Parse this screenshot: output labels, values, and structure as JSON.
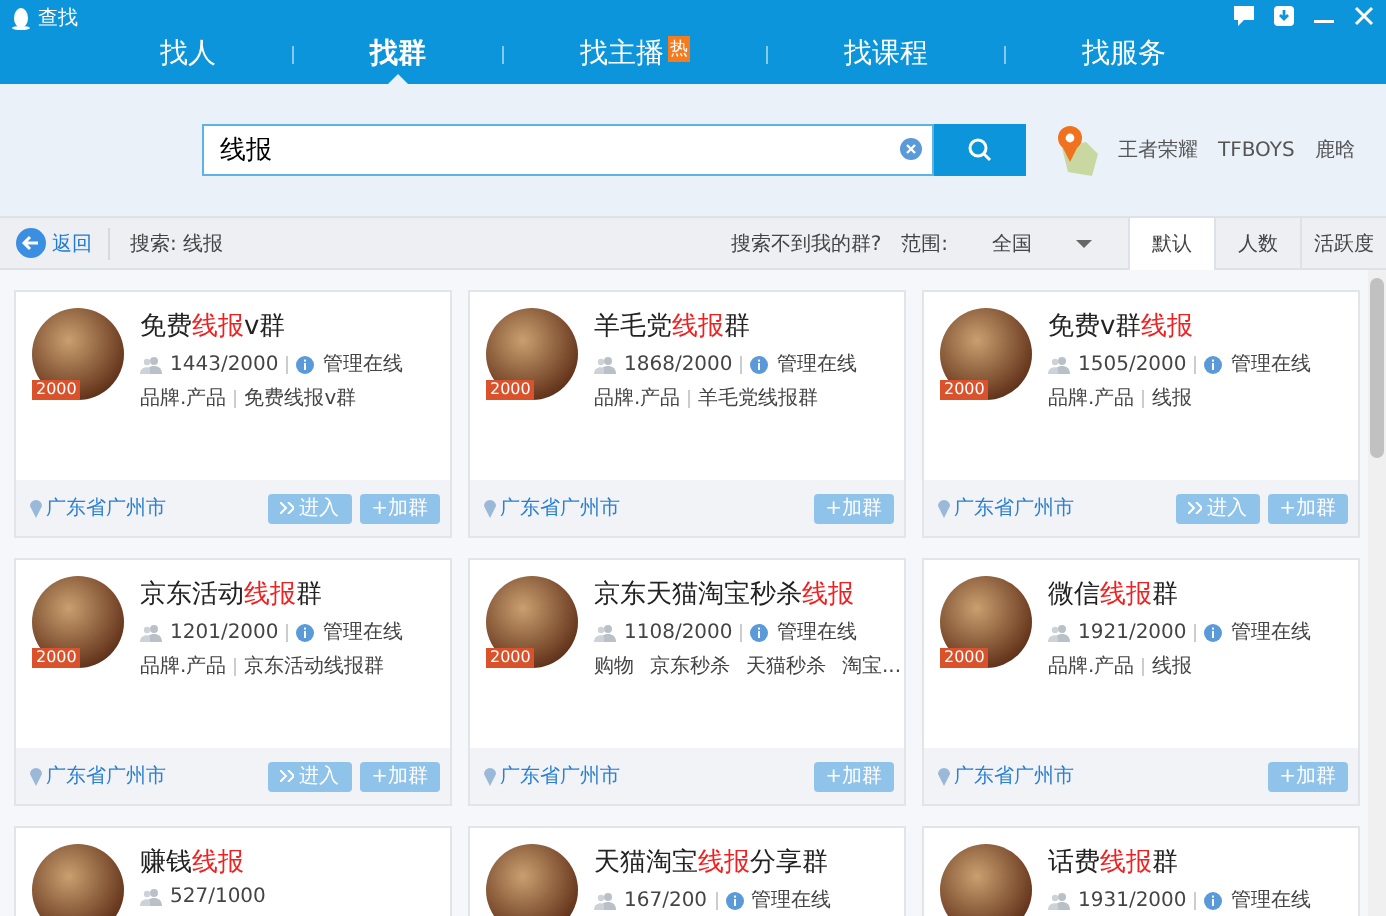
{
  "window": {
    "title": "查找"
  },
  "tabs": [
    {
      "label": "找人",
      "selected": false
    },
    {
      "label": "找群",
      "selected": true
    },
    {
      "label": "找主播",
      "selected": false,
      "hot": "热"
    },
    {
      "label": "找课程",
      "selected": false
    },
    {
      "label": "找服务",
      "selected": false
    }
  ],
  "search": {
    "value": "线报",
    "hot_words": [
      "王者荣耀",
      "TFBOYS",
      "鹿晗"
    ]
  },
  "filter_bar": {
    "back": "返回",
    "query": "搜索: 线报",
    "not_found": "搜索不到我的群?",
    "range_label": "范围:",
    "range_value": "全国",
    "sorts": [
      {
        "label": "默认",
        "selected": true
      },
      {
        "label": "人数",
        "selected": false
      },
      {
        "label": "活跃度",
        "selected": false
      }
    ]
  },
  "groups": [
    {
      "name": [
        {
          "text": "免费",
          "highlight": false
        },
        {
          "text": "线报",
          "highlight": true
        },
        {
          "text": "v群",
          "highlight": false
        }
      ],
      "badge": "2000",
      "members": "1443/2000",
      "admin": "管理在线",
      "tags": [
        "品牌.产品",
        "免费线报v群"
      ],
      "location": "广东省广州市",
      "enter": "进入",
      "join": "+加群"
    },
    {
      "name": [
        {
          "text": "羊毛党",
          "highlight": false
        },
        {
          "text": "线报",
          "highlight": true
        },
        {
          "text": "群",
          "highlight": false
        }
      ],
      "badge": "2000",
      "members": "1868/2000",
      "admin": "管理在线",
      "tags": [
        "品牌.产品",
        "羊毛党线报群"
      ],
      "location": "广东省广州市",
      "join": "+加群"
    },
    {
      "name": [
        {
          "text": "免费v群",
          "highlight": false
        },
        {
          "text": "线报",
          "highlight": true
        }
      ],
      "badge": "2000",
      "members": "1505/2000",
      "admin": "管理在线",
      "tags": [
        "品牌.产品",
        "线报"
      ],
      "location": "广东省广州市",
      "enter": "进入",
      "join": "+加群"
    },
    {
      "name": [
        {
          "text": "京东活动",
          "highlight": false
        },
        {
          "text": "线报",
          "highlight": true
        },
        {
          "text": "群",
          "highlight": false
        }
      ],
      "badge": "2000",
      "members": "1201/2000",
      "admin": "管理在线",
      "tags": [
        "品牌.产品",
        "京东活动线报群"
      ],
      "location": "广东省广州市",
      "enter": "进入",
      "join": "+加群"
    },
    {
      "name": [
        {
          "text": "京东天猫淘宝秒杀",
          "highlight": false
        },
        {
          "text": "线报",
          "highlight": true
        }
      ],
      "badge": "2000",
      "members": "1108/2000",
      "admin": "管理在线",
      "tags": [
        "购物",
        "京东秒杀",
        "天猫秒杀",
        "淘宝..."
      ],
      "location": "广东省广州市",
      "join": "+加群"
    },
    {
      "name": [
        {
          "text": "微信",
          "highlight": false
        },
        {
          "text": "线报",
          "highlight": true
        },
        {
          "text": "群",
          "highlight": false
        }
      ],
      "badge": "2000",
      "members": "1921/2000",
      "admin": "管理在线",
      "tags": [
        "品牌.产品",
        "线报"
      ],
      "location": "广东省广州市",
      "join": "+加群"
    },
    {
      "name": [
        {
          "text": "赚钱",
          "highlight": false
        },
        {
          "text": "线报",
          "highlight": true
        }
      ],
      "members": "527/1000"
    },
    {
      "name": [
        {
          "text": "天猫淘宝",
          "highlight": false
        },
        {
          "text": "线报",
          "highlight": true
        },
        {
          "text": "分享群",
          "highlight": false
        }
      ],
      "members": "167/200",
      "admin": "管理在线"
    },
    {
      "name": [
        {
          "text": "话费",
          "highlight": false
        },
        {
          "text": "线报",
          "highlight": true
        },
        {
          "text": "群",
          "highlight": false
        }
      ],
      "members": "1931/2000",
      "admin": "管理在线"
    }
  ]
}
